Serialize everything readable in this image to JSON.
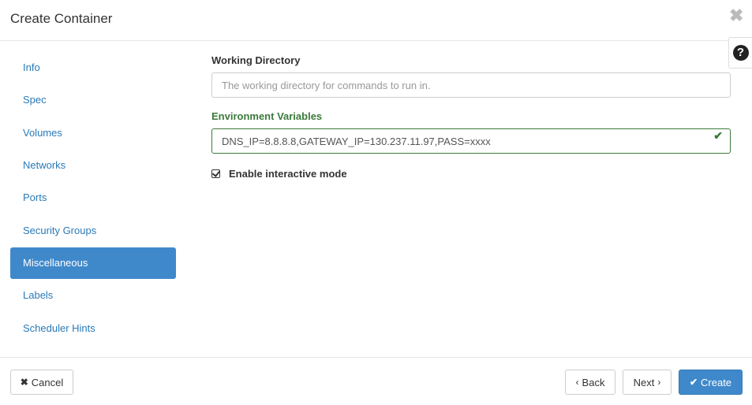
{
  "header": {
    "title": "Create Container",
    "close_glyph": "✖",
    "help_glyph": "?"
  },
  "nav": {
    "items": [
      {
        "label": "Info",
        "active": false
      },
      {
        "label": "Spec",
        "active": false
      },
      {
        "label": "Volumes",
        "active": false
      },
      {
        "label": "Networks",
        "active": false
      },
      {
        "label": "Ports",
        "active": false
      },
      {
        "label": "Security Groups",
        "active": false
      },
      {
        "label": "Miscellaneous",
        "active": true
      },
      {
        "label": "Labels",
        "active": false
      },
      {
        "label": "Scheduler Hints",
        "active": false
      }
    ]
  },
  "form": {
    "working_directory": {
      "label": "Working Directory",
      "value": "",
      "placeholder": "The working directory for commands to run in."
    },
    "environment_variables": {
      "label": "Environment Variables",
      "value": "DNS_IP=8.8.8.8,GATEWAY_IP=130.237.11.97,PASS=xxxx",
      "status": "success",
      "feedback_glyph": "✔"
    },
    "interactive": {
      "label": "Enable interactive mode",
      "checked": true
    }
  },
  "footer": {
    "cancel_label": "Cancel",
    "cancel_glyph": "✖",
    "back_label": "Back",
    "back_glyph": "‹",
    "next_label": "Next",
    "next_glyph": "›",
    "create_label": "Create",
    "create_glyph": "✔"
  },
  "colors": {
    "accent": "#3f89cb",
    "link": "#2a7ab8",
    "success": "#3c7a3c"
  },
  "icons": {
    "close": "close-icon",
    "help": "question-circle-icon",
    "feedback": "check-icon",
    "checkbox": "checked-box-icon",
    "cancel": "times-icon",
    "back": "chevron-left-icon",
    "next": "chevron-right-icon",
    "create": "check-icon"
  }
}
